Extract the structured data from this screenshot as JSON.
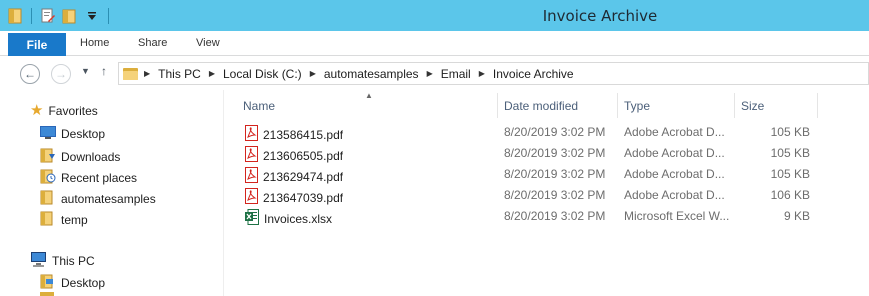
{
  "window": {
    "title": "Invoice Archive"
  },
  "ribbon": {
    "file": "File",
    "home": "Home",
    "share": "Share",
    "view": "View"
  },
  "address": {
    "crumbs": [
      "This PC",
      "Local Disk (C:)",
      "automatesamples",
      "Email",
      "Invoice Archive"
    ]
  },
  "nav": {
    "favorites": "Favorites",
    "desktop": "Desktop",
    "downloads": "Downloads",
    "recent": "Recent places",
    "automatesamples": "automatesamples",
    "temp": "temp",
    "thispc": "This PC",
    "pc_desktop": "Desktop"
  },
  "columns": {
    "name": "Name",
    "date": "Date modified",
    "type": "Type",
    "size": "Size"
  },
  "files": [
    {
      "name": "213586415.pdf",
      "date": "8/20/2019 3:02 PM",
      "type": "Adobe Acrobat D...",
      "size": "105 KB",
      "icon": "pdf-file-icon"
    },
    {
      "name": "213606505.pdf",
      "date": "8/20/2019 3:02 PM",
      "type": "Adobe Acrobat D...",
      "size": "105 KB",
      "icon": "pdf-file-icon"
    },
    {
      "name": "213629474.pdf",
      "date": "8/20/2019 3:02 PM",
      "type": "Adobe Acrobat D...",
      "size": "105 KB",
      "icon": "pdf-file-icon"
    },
    {
      "name": "213647039.pdf",
      "date": "8/20/2019 3:02 PM",
      "type": "Adobe Acrobat D...",
      "size": "106 KB",
      "icon": "pdf-file-icon"
    },
    {
      "name": "Invoices.xlsx",
      "date": "8/20/2019 3:02 PM",
      "type": "Microsoft Excel W...",
      "size": "9 KB",
      "icon": "excel-file-icon"
    }
  ],
  "colors": {
    "titlebar": "#5bc6ea",
    "file_tab": "#1979ca",
    "folder": "#f5d27a",
    "pdf_red": "#d3241d",
    "excel_green": "#1e7145"
  }
}
